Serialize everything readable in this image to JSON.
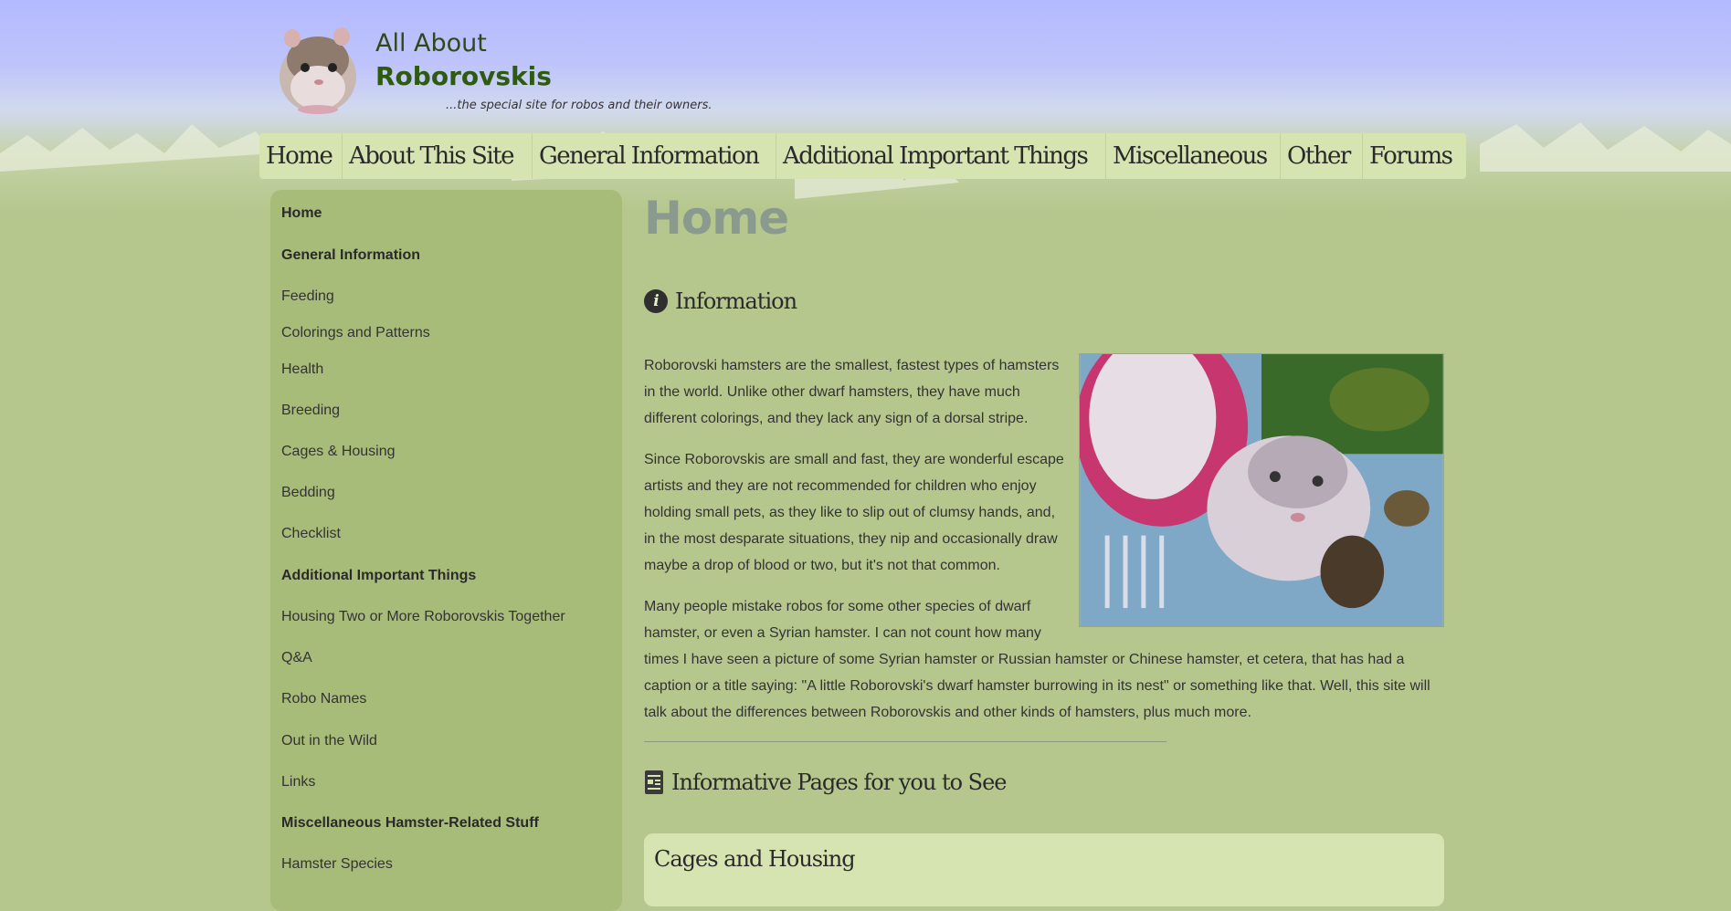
{
  "header": {
    "title_line1": "All About",
    "title_line2": "Roborovskis",
    "tagline": "...the special site for robos and their owners."
  },
  "topnav": {
    "tabs": [
      "Home",
      "About This Site",
      "General Information",
      "Additional Important Things",
      "Miscellaneous",
      "Other",
      "Forums"
    ]
  },
  "sidebar": {
    "items": [
      {
        "label": "Home",
        "heading": true
      },
      {
        "label": "General Information",
        "heading": true
      },
      {
        "label": "Feeding",
        "heading": false
      },
      {
        "label": "Colorings and Patterns",
        "heading": false
      },
      {
        "label": "Health",
        "heading": false
      },
      {
        "label": "Breeding",
        "heading": false
      },
      {
        "label": "Cages & Housing",
        "heading": false
      },
      {
        "label": "Bedding",
        "heading": false
      },
      {
        "label": "Checklist",
        "heading": false
      },
      {
        "label": "Additional Important Things",
        "heading": true
      },
      {
        "label": "Housing Two or More Roborovskis Together",
        "heading": false
      },
      {
        "label": "Q&A",
        "heading": false
      },
      {
        "label": "Robo Names",
        "heading": false
      },
      {
        "label": "Out in the Wild",
        "heading": false
      },
      {
        "label": "Links",
        "heading": false
      },
      {
        "label": "Miscellaneous Hamster-Related Stuff",
        "heading": true
      },
      {
        "label": "Hamster Species",
        "heading": false
      }
    ]
  },
  "main": {
    "page_title": "Home",
    "info_section": {
      "icon": "info-icon",
      "title": "Information",
      "paragraphs": [
        "Roborovski hamsters are the smallest, fastest types of hamsters in the world. Unlike other dwarf hamsters, they have much different colorings, and they lack any sign of a dorsal stripe.",
        "Since Roborovskis are small and fast, they are wonderful escape artists and they are not recommended for children who enjoy holding small pets, as they like to slip out of clumsy hands, and, in the most desparate situations, they nip and occasionally draw maybe a drop of blood or two, but it's not that common.",
        "Many people mistake robos for some other species of dwarf hamster, or even a Syrian hamster. I can not count how many times I have seen a picture of some Syrian hamster or Russian hamster or Chinese hamster, et cetera, that has had a caption or a title saying: \"A little Roborovski's dwarf hamster burrowing in its nest\" or something like that. Well, this site will talk about the differences between Roborovskis and other kinds of hamsters, plus much more."
      ]
    },
    "pages_section": {
      "icon": "document-icon",
      "title": "Informative Pages for you to See"
    },
    "card": {
      "title": "Cages and Housing"
    }
  },
  "colors": {
    "sky": "#b3baff",
    "background": "#b6c78e",
    "nav_bg": "#d6e4b2",
    "sidebar_bg": "#a8bc7a",
    "title_green": "#2e5a12",
    "heading_gray": "#8a9a8e"
  }
}
